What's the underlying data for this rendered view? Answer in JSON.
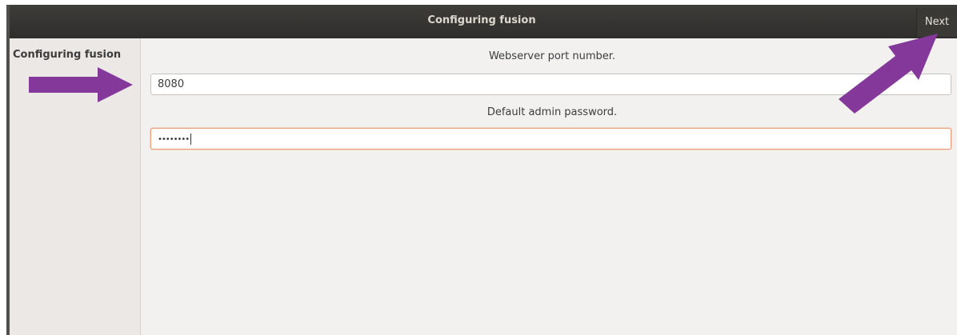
{
  "window": {
    "title": "Configuring fusion",
    "next_label": "Next"
  },
  "sidebar": {
    "items": [
      {
        "label": "Configuring fusion"
      }
    ]
  },
  "form": {
    "port": {
      "label": "Webserver port number.",
      "value": "8080"
    },
    "password": {
      "label": "Default admin password.",
      "value": "••••••••"
    }
  },
  "colors": {
    "annotation_arrow": "#84399a",
    "titlebar": "#3c3b37",
    "focus_border": "#e9a07a"
  },
  "icons": {
    "annotation_arrows": [
      "arrow-right-icon",
      "arrow-up-right-icon"
    ]
  }
}
